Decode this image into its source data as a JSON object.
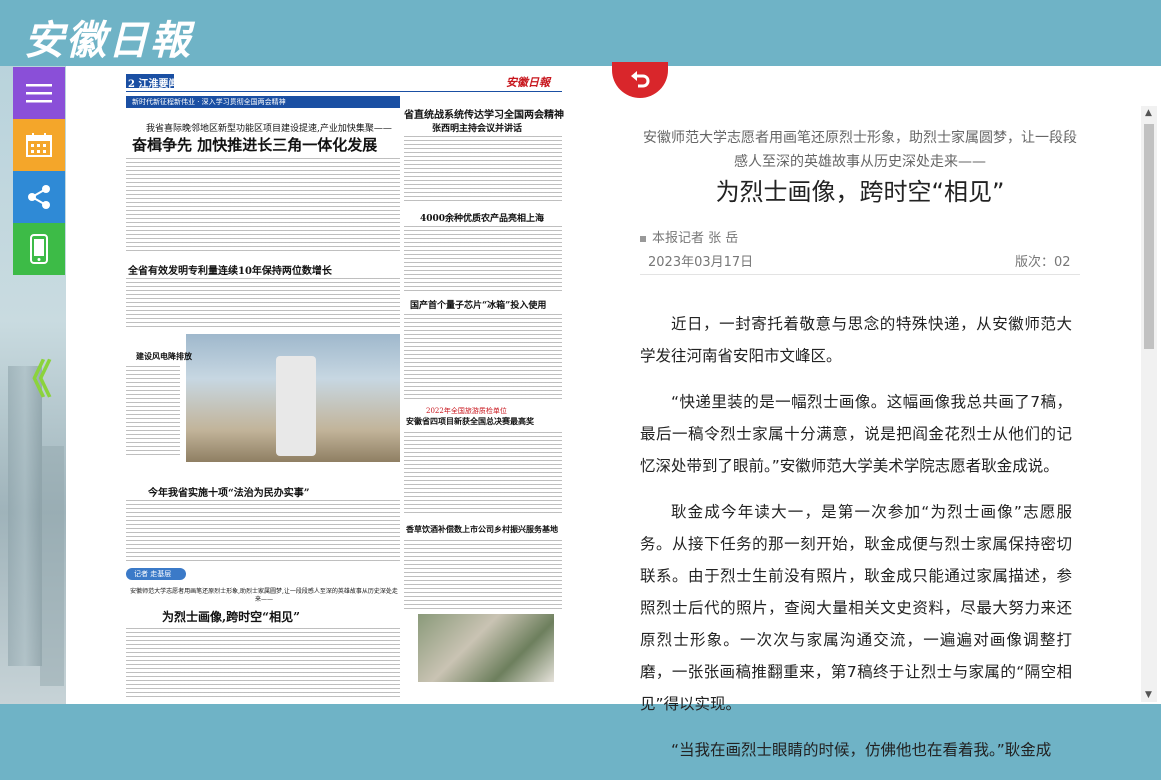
{
  "brand": {
    "logo": "安徽日報"
  },
  "sidebar": {
    "collapse_glyph": "《"
  },
  "newspaper": {
    "page_label": "2 江淮要闻",
    "masthead": "安徽日報",
    "banner_tag": "新时代新征程新伟业 · 深入学习贯彻全国两会精神",
    "lead_kicker": "我省喜际晚邻地区新型功能区项目建设提速,产业加快集聚——",
    "lead_headline": "奋楫争先 加快推进长三角一体化发展",
    "right_head1": "省直统战系统传达学习全国两会精神",
    "right_sub1": "张西明主持会议并讲话",
    "right_head2": "4000余种优质农产品亮相上海",
    "right_head3": "国产首个量子芯片“冰箱”投入使用",
    "mid_head1": "全省有效发明专利量连续10年保持两位数增长",
    "photo_caption": "建设风电降排放",
    "right_kicker4": "2022年全国旅游质检单位",
    "right_head4": "安徽省四项目新获全国总决赛最高奖",
    "law_head": "今年我省实施十项“法治为民办实事”",
    "reporter_tag": "记者 走基层",
    "bottom_kicker": "安徽师范大学志愿者用画笔还原烈士形象,助烈士家属圆梦,让一段段感人至深的英雄故事从历史深处走来——",
    "bottom_head": "为烈士画像,跨时空“相见”",
    "right_head5": "香草饮酒补偿数上市公司乡村振兴服务基地"
  },
  "article": {
    "subtitle": "安徽师范大学志愿者用画笔还原烈士形象，助烈士家属圆梦，让一段段感人至深的英雄故事从历史深处走来——",
    "title": "为烈士画像，跨时空“相见”",
    "author": "本报记者 张 岳",
    "date": "2023年03月17日",
    "edition": "版次：02",
    "paragraphs": [
      "近日，一封寄托着敬意与思念的特殊快递，从安徽师范大学发往河南省安阳市文峰区。",
      "“快递里装的是一幅烈士画像。这幅画像我总共画了7稿，最后一稿令烈士家属十分满意，说是把阎金花烈士从他们的记忆深处带到了眼前。”安徽师范大学美术学院志愿者耿金成说。",
      "耿金成今年读大一，是第一次参加“为烈士画像”志愿服务。从接下任务的那一刻开始，耿金成便与烈士家属保持密切联系。由于烈士生前没有照片，耿金成只能通过家属描述，参照烈士后代的照片，查阅大量相关文史资料，尽最大努力来还原烈士形象。一次次与家属沟通交流，一遍遍对画像调整打磨，一张张画稿推翻重来，第7稿终于让烈士与家属的“隔空相见”得以实现。",
      "“当我在画烈士眼睛的时候，仿佛他也在看着我。”耿金成"
    ]
  },
  "colors": {
    "header": "#6fb3c6",
    "menu": "#8a4fd8",
    "calendar": "#f4a62a",
    "share": "#2f8ad6",
    "mobile": "#3dbb47",
    "back": "#d9262b",
    "chevron": "#8bd33c"
  }
}
